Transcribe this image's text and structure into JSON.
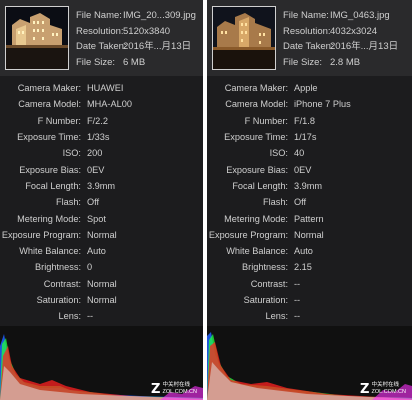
{
  "left": {
    "file": {
      "name_label": "File Name:",
      "name": "IMG_20...309.jpg",
      "res_label": "Resolution:",
      "resolution": "5120x3840",
      "date_label": "Date Taken:",
      "date": "2016年...月13日",
      "size_label": "File Size:",
      "size": "6 MB"
    },
    "meta": [
      {
        "k": "Camera Maker:",
        "v": "HUAWEI"
      },
      {
        "k": "Camera Model:",
        "v": "MHA-AL00"
      },
      {
        "k": "F Number:",
        "v": "F/2.2"
      },
      {
        "k": "Exposure Time:",
        "v": "1/33s"
      },
      {
        "k": "ISO:",
        "v": "200"
      },
      {
        "k": "Exposure Bias:",
        "v": "0EV"
      },
      {
        "k": "Focal Length:",
        "v": "3.9mm"
      },
      {
        "k": "Flash:",
        "v": "Off"
      },
      {
        "k": "Metering Mode:",
        "v": "Spot"
      },
      {
        "k": "Exposure Program:",
        "v": "Normal"
      },
      {
        "k": "White Balance:",
        "v": "Auto"
      },
      {
        "k": "Brightness:",
        "v": "0"
      },
      {
        "k": "Contrast:",
        "v": "Normal"
      },
      {
        "k": "Saturation:",
        "v": "Normal"
      },
      {
        "k": "Lens:",
        "v": "--"
      }
    ],
    "watermark": {
      "brand": "中关村在线",
      "url": "ZOL.COM.CN"
    }
  },
  "right": {
    "file": {
      "name_label": "File Name:",
      "name": "IMG_0463.jpg",
      "res_label": "Resolution:",
      "resolution": "4032x3024",
      "date_label": "Date Taken:",
      "date": "2016年...月13日",
      "size_label": "File Size:",
      "size": "2.8 MB"
    },
    "meta": [
      {
        "k": "Camera Maker:",
        "v": "Apple"
      },
      {
        "k": "Camera Model:",
        "v": "iPhone 7 Plus"
      },
      {
        "k": "F Number:",
        "v": "F/1.8"
      },
      {
        "k": "Exposure Time:",
        "v": "1/17s"
      },
      {
        "k": "ISO:",
        "v": "40"
      },
      {
        "k": "Exposure Bias:",
        "v": "0EV"
      },
      {
        "k": "Focal Length:",
        "v": "3.9mm"
      },
      {
        "k": "Flash:",
        "v": "Off"
      },
      {
        "k": "Metering Mode:",
        "v": "Pattern"
      },
      {
        "k": "Exposure Program:",
        "v": "Normal"
      },
      {
        "k": "White Balance:",
        "v": "Auto"
      },
      {
        "k": "Brightness:",
        "v": "2.15"
      },
      {
        "k": "Contrast:",
        "v": "--"
      },
      {
        "k": "Saturation:",
        "v": "--"
      },
      {
        "k": "Lens:",
        "v": "--"
      }
    ],
    "watermark": {
      "brand": "中关村在线",
      "url": "ZOL.COM.CN"
    }
  }
}
